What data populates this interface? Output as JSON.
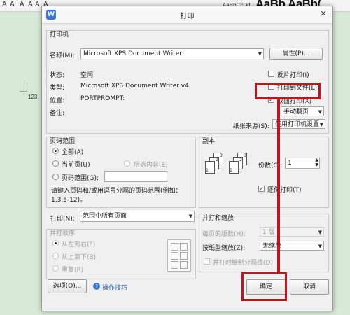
{
  "background": {
    "toolbar_letters": [
      "A",
      "A",
      "A",
      "A·",
      "A",
      "A"
    ],
    "style_sample_small": "AaBbCcDd",
    "style_sample_large": "AaBb AaBb(",
    "page_number": "123"
  },
  "dialog": {
    "title": "打印",
    "app_icon": "W",
    "printer_section": {
      "label": "打印机",
      "name_label": "名称(M):",
      "name_value": "Microsoft XPS Document Writer",
      "properties_button": "属性(P)...",
      "status_label": "状态:",
      "status_value": "空闲",
      "type_label": "类型:",
      "type_value": "Microsoft XPS Document Writer v4",
      "location_label": "位置:",
      "location_value": "PORTPROMPT:",
      "comment_label": "备注:",
      "reverse_print": "反片打印(I)",
      "print_to_file": "打印到文件(L)",
      "duplex_print": "双面打印(X)",
      "duplex_mode_value": "手动翻页",
      "paper_source_label": "纸张来源(S):",
      "paper_source_value": "使用打印机设置"
    },
    "page_range": {
      "label": "页码范围",
      "all": "全部(A)",
      "current": "当前页(U)",
      "selection": "所选内容(E)",
      "pages": "页码范围(G):",
      "hint": "请键入页码和/或用逗号分隔的页码范围(例如：1,3,5-12)。"
    },
    "print_what": {
      "label": "打印(N):",
      "value": "范围中所有页面"
    },
    "collate_order": {
      "label": "并打顺序",
      "left_to_right": "从左到右(F)",
      "top_to_bottom": "从上到下(B)",
      "repeat": "重复(R)"
    },
    "copies": {
      "label": "副本",
      "count_label": "份数(C):",
      "count_value": "1",
      "collate": "逐份打印(T)"
    },
    "zoom": {
      "label": "并打和缩放",
      "pages_per_sheet_label": "每页的版数(H):",
      "pages_per_sheet_value": "1 版",
      "scale_label": "按纸型缩放(Z):",
      "scale_value": "无缩放",
      "draw_lines": "并打时绘制分隔线(D)"
    },
    "footer": {
      "options_button": "选项(O)...",
      "tips_link": "操作技巧",
      "ok_button": "确定",
      "cancel_button": "取消"
    }
  },
  "colors": {
    "annotation_red": "#c0161a",
    "accent_blue": "#3a78d8"
  }
}
